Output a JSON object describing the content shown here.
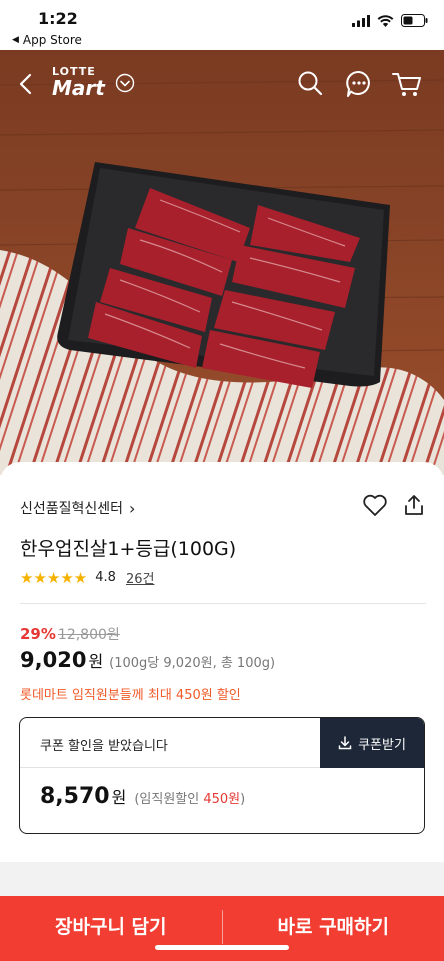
{
  "status_bar": {
    "time": "1:22",
    "back_app": "App Store",
    "back_icon": "triangle-left-icon"
  },
  "header": {
    "logo_top": "LOTTE",
    "logo_bottom": "Mart",
    "icons": [
      "back-arrow-icon",
      "chevron-down-icon",
      "search-icon",
      "chat-icon",
      "cart-icon"
    ]
  },
  "product": {
    "seller": "신선품질혁신센터",
    "seller_chevron": "›",
    "title": "한우업진살1+등급(100G)",
    "stars": "★★★★★",
    "rating": "4.8",
    "review_count": "26건",
    "discount_pct": "29%",
    "original_price": "12,800원",
    "price": "9,020",
    "price_unit": "원",
    "unit_note": "(100g당 9,020원, 총 100g)",
    "employee_note": "롯데마트 임직원분들께 최대 450원 할인"
  },
  "coupon": {
    "message": "쿠폰 할인을 받았습니다",
    "button": "쿠폰받기",
    "final_price": "8,570",
    "final_unit": "원",
    "note_prefix": "(임직원할인 ",
    "note_amount": "450원",
    "note_suffix": ")"
  },
  "bottom_bar": {
    "cart_button": "장바구니 담기",
    "buy_button": "바로 구매하기"
  },
  "colors": {
    "accent_red": "#f23d32",
    "discount_red": "#e53935",
    "orange": "#f05a28",
    "coupon_button": "#1e2738",
    "star": "#f5b300"
  }
}
